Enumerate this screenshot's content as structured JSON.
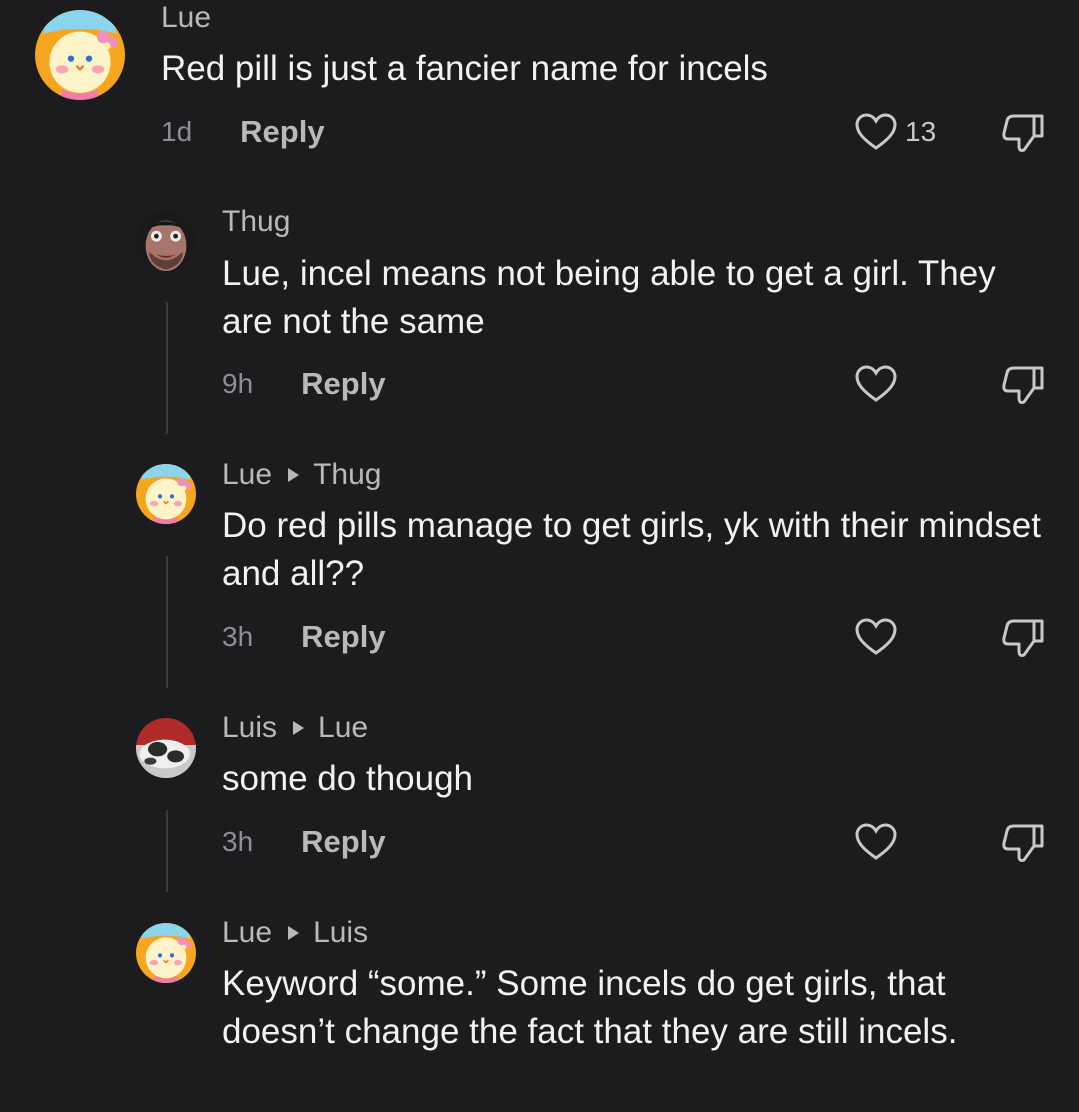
{
  "colors": {
    "background": "#1c1c1e",
    "text_primary": "#f2f2f2",
    "text_secondary": "#b9b9bb",
    "text_muted": "#8e8e93"
  },
  "comments": [
    {
      "author": "Lue",
      "reply_to": "",
      "text": "Red pill is just a fancier name for incels",
      "time": "1d",
      "reply_label": "Reply",
      "likes": "13",
      "avatar": "pastel-bunny-avatar"
    },
    {
      "author": "Thug",
      "reply_to": "",
      "text": "Lue, incel means not being able to get a girl. They are not the same",
      "time": "9h",
      "reply_label": "Reply",
      "likes": "",
      "avatar": "face-photo-avatar"
    },
    {
      "author": "Lue",
      "reply_to": "Thug",
      "text": "Do red pills manage to get girls, yk with their mindset and all??",
      "time": "3h",
      "reply_label": "Reply",
      "likes": "",
      "avatar": "pastel-bunny-avatar"
    },
    {
      "author": "Luis",
      "reply_to": "Lue",
      "text": "some do though",
      "time": "3h",
      "reply_label": "Reply",
      "likes": "",
      "avatar": "cat-photo-avatar"
    },
    {
      "author": "Lue",
      "reply_to": "Luis",
      "text": "Keyword “some.” Some incels do get girls, that doesn’t change the fact that they are still incels.",
      "time": "",
      "reply_label": "",
      "likes": "",
      "avatar": "pastel-bunny-avatar"
    }
  ]
}
